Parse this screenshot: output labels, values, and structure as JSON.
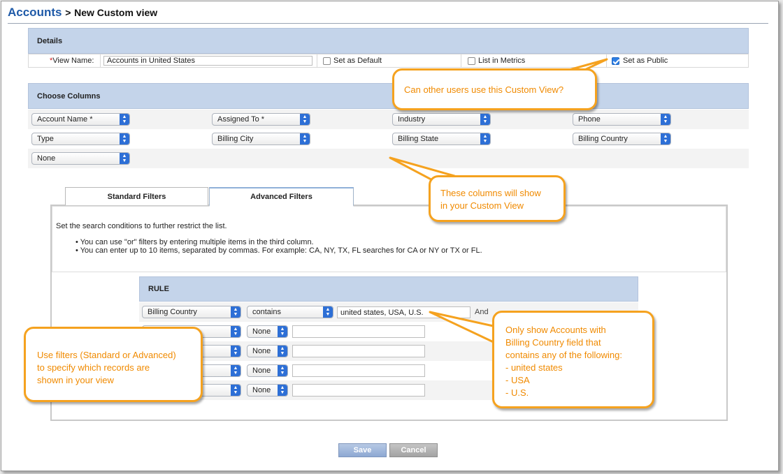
{
  "header": {
    "breadcrumb": "Accounts",
    "separator": ">",
    "title": "New Custom view"
  },
  "details": {
    "heading": "Details",
    "view_name_required": "*",
    "view_name_label": "View Name:",
    "view_name_value": "Accounts in United States",
    "set_default_label": "Set as Default",
    "set_default_checked": false,
    "list_metrics_label": "List in Metrics",
    "list_metrics_checked": false,
    "set_public_label": "Set as Public",
    "set_public_checked": true
  },
  "columns": {
    "heading": "Choose Columns",
    "selects": [
      "Account Name *",
      "Assigned To *",
      "Industry",
      "Phone",
      "Type",
      "Billing City",
      "Billing State",
      "Billing Country",
      "None"
    ]
  },
  "filters": {
    "tabs": [
      "Standard Filters",
      "Advanced Filters"
    ],
    "active_tab": "Advanced Filters",
    "intro": "Set the search conditions to further restrict the list.",
    "bullets": [
      "You can use \"or\" filters by entering multiple items in the third column.",
      "You can enter up to 10 items, separated by commas. For example: CA, NY, TX, FL searches for CA or NY or TX or FL."
    ],
    "rule_heading": "RULE",
    "rules": [
      {
        "field": "Billing Country",
        "operator": "contains",
        "value": "united states, USA, U.S.",
        "join": "And"
      },
      {
        "field": "",
        "operator": "None",
        "value": ""
      },
      {
        "field": "",
        "operator": "None",
        "value": ""
      },
      {
        "field": "",
        "operator": "None",
        "value": ""
      },
      {
        "field": "",
        "operator": "None",
        "value": ""
      }
    ]
  },
  "callouts": {
    "public": [
      "Can other users use this Custom View?"
    ],
    "columns": [
      "These columns will show",
      "in your Custom View"
    ],
    "filters": [
      "Use filters (Standard or Advanced)",
      "to specify which records are",
      "shown in your view"
    ],
    "rule": [
      "Only show Accounts with",
      "Billing Country field that",
      "contains any of the following:",
      "- united states",
      "- USA",
      "- U.S."
    ]
  },
  "buttons": {
    "save": "Save",
    "cancel": "Cancel"
  },
  "colors": {
    "accent": "#1f5aa8",
    "section_header": "#c4d4ea",
    "callout_border": "#f5a21f",
    "callout_text": "#f08a00",
    "select_arrow": "#2d6fd6"
  }
}
